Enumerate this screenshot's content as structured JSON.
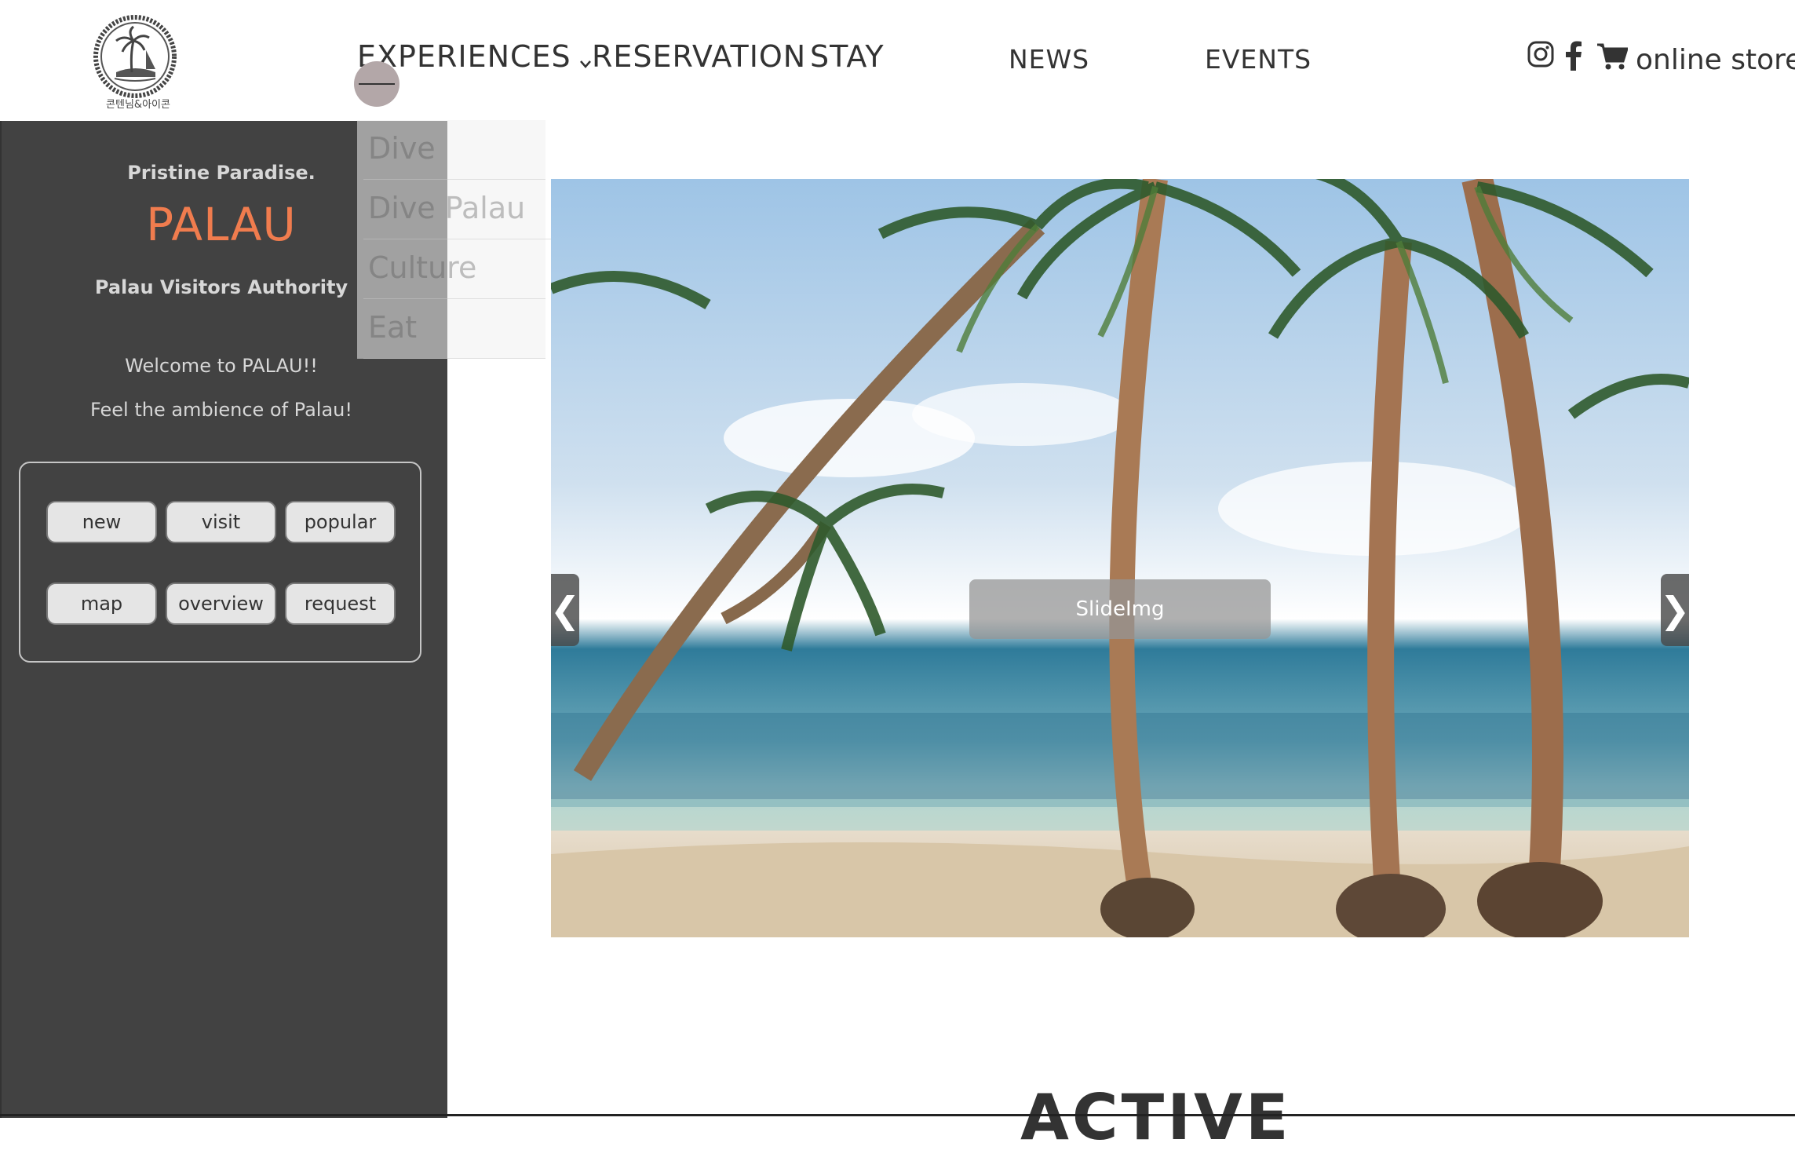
{
  "logo": {
    "caption": "콘텐님&아이콘",
    "icon": "palm-island-logo"
  },
  "nav": {
    "experiences": "EXPERIENCES",
    "reservation": "RESERVATION",
    "stay": "STAY",
    "news": "NEWS",
    "events": "EVENTS",
    "online_store": "online store"
  },
  "social": {
    "instagram": "instagram-icon",
    "facebook": "facebook-icon",
    "cart": "cart-icon"
  },
  "dropdown": {
    "items": [
      {
        "label": "Dive"
      },
      {
        "label": "Dive Palau"
      },
      {
        "label": "Culture"
      },
      {
        "label": "Eat"
      }
    ]
  },
  "sidebar": {
    "tagline": "Pristine Paradise.",
    "brand": "PALAU",
    "organization": "Palau Visitors Authority",
    "welcome1": "Welcome to PALAU!!",
    "welcome2": "Feel the ambience of Palau!",
    "buttons": [
      {
        "label": "new"
      },
      {
        "label": "visit"
      },
      {
        "label": "popular"
      },
      {
        "label": "map"
      },
      {
        "label": "overview"
      },
      {
        "label": "request"
      }
    ],
    "brand_color": "#f07c4e",
    "background": "#424242"
  },
  "slider": {
    "caption": "SlideImg",
    "prev": "❮",
    "next": "❯"
  },
  "section": {
    "heading": "ACTIVE"
  }
}
